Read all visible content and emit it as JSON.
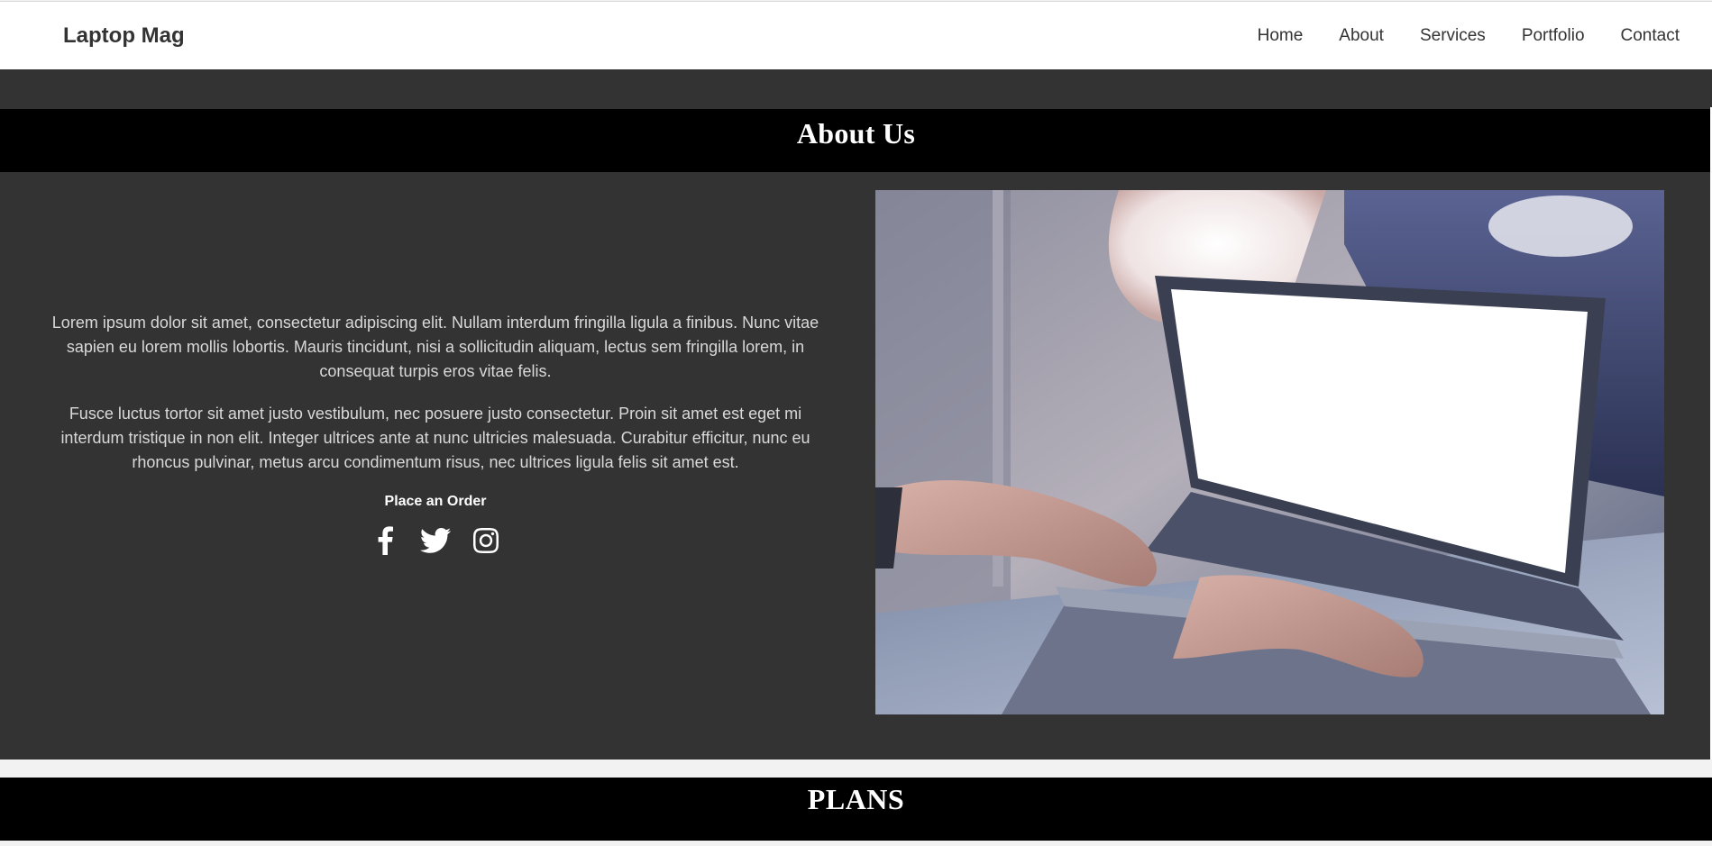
{
  "navbar": {
    "brand": "Laptop Mag",
    "links": [
      "Home",
      "About",
      "Services",
      "Portfolio",
      "Contact"
    ]
  },
  "about": {
    "title": "About Us",
    "paragraphs": [
      "Lorem ipsum dolor sit amet, consectetur adipiscing elit. Nullam interdum fringilla ligula a finibus. Nunc vitae sapien eu lorem mollis lobortis. Mauris tincidunt, nisi a sollicitudin aliquam, lectus sem fringilla lorem, in consequat turpis eros vitae felis.",
      "Fusce luctus tortor sit amet justo vestibulum, nec posuere justo consectetur. Proin sit amet est eget mi interdum tristique in non elit. Integer ultrices ante at nunc ultricies malesuada. Curabitur efficitur, nunc eu rhoncus pulvinar, metus arcu condimentum risus, nec ultrices ligula felis sit amet est."
    ],
    "order_label": "Place an Order",
    "social_icons": [
      "facebook-icon",
      "twitter-icon",
      "instagram-icon"
    ]
  },
  "plans": {
    "title": "PLANS"
  },
  "colors": {
    "navbar_bg": "#ffffff",
    "section_bg": "#333333",
    "title_bar_bg": "#000000",
    "text": "#d9d9d9",
    "heading": "#ffffff",
    "nav_text": "#333333"
  }
}
